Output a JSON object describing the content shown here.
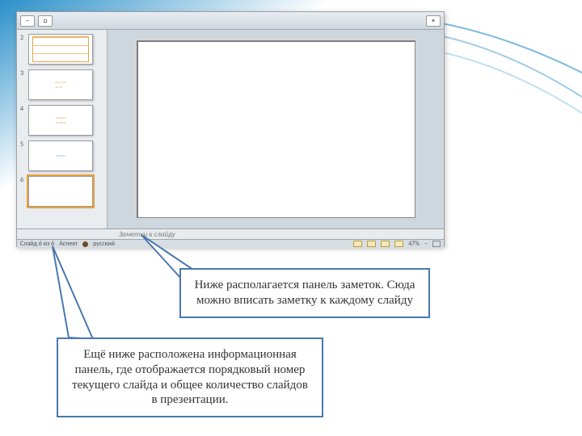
{
  "app": {
    "notes_placeholder": "Заметки к слайду",
    "status": {
      "slide_label": "Слайд 6 из 6",
      "theme_label": "Аспект",
      "lang": "русский",
      "zoom": "47%"
    },
    "thumbs": [
      {
        "n": "2"
      },
      {
        "n": "3"
      },
      {
        "n": "4"
      },
      {
        "n": "5"
      },
      {
        "n": "6"
      }
    ]
  },
  "callout_top": "Ниже располагается панель заметок. Сюда можно вписать заметку к каждому слайду",
  "callout_bottom": "Ещё ниже расположена информационная панель, где отображается порядковый номер текущего слайда и общее количество слайдов в презентации."
}
